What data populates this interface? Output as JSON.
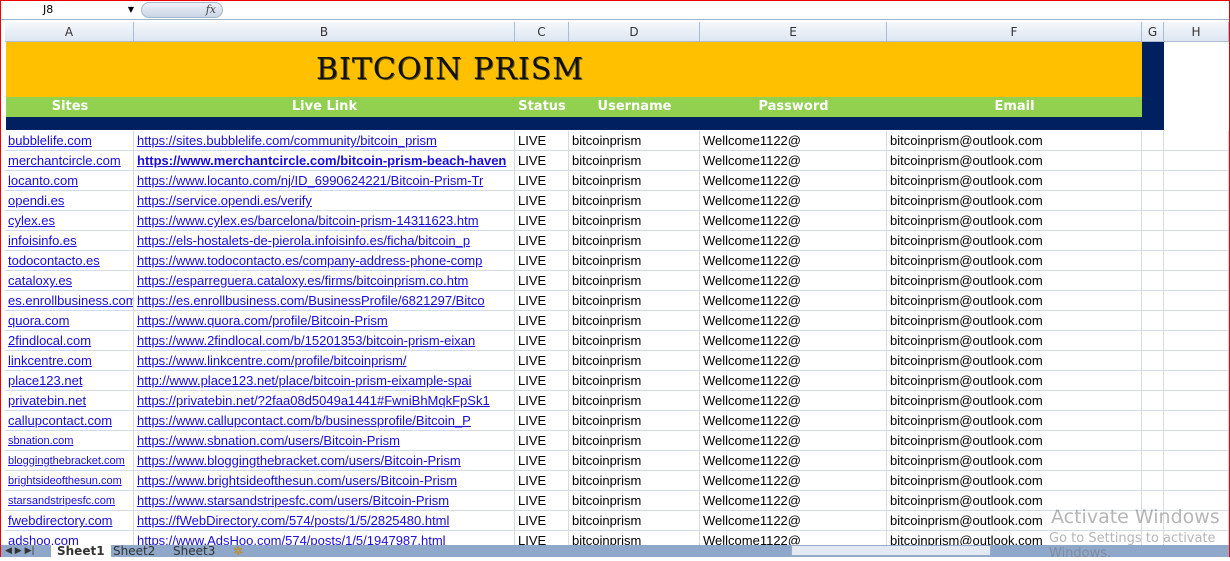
{
  "formula_bar": {
    "name_box": "J8",
    "fx": "fx"
  },
  "columns": [
    "A",
    "B",
    "C",
    "D",
    "E",
    "F",
    "G",
    "H"
  ],
  "title": "BITCOIN PRISM",
  "headers": [
    "Sites",
    "Live Link",
    "Status",
    "Username",
    "Password",
    "Email"
  ],
  "rows": [
    [
      "bubblelife.com",
      "https://sites.bubblelife.com/community/bitcoin_prism",
      "LIVE",
      "bitcoinprism",
      "Wellcome1122@",
      "bitcoinprism@outlook.com"
    ],
    [
      "merchantcircle.com",
      "https://www.merchantcircle.com/bitcoin-prism-beach-haven",
      "LIVE",
      "bitcoinprism",
      "Wellcome1122@",
      "bitcoinprism@outlook.com"
    ],
    [
      "locanto.com",
      "https://www.locanto.com/nj/ID_6990624221/Bitcoin-Prism-Tr",
      "LIVE",
      "bitcoinprism",
      "Wellcome1122@",
      "bitcoinprism@outlook.com"
    ],
    [
      "opendi.es",
      "https://service.opendi.es/verify",
      "LIVE",
      "bitcoinprism",
      "Wellcome1122@",
      "bitcoinprism@outlook.com"
    ],
    [
      "cylex.es",
      "https://www.cylex.es/barcelona/bitcoin-prism-14311623.htm",
      "LIVE",
      "bitcoinprism",
      "Wellcome1122@",
      "bitcoinprism@outlook.com"
    ],
    [
      "infoisinfo.es",
      "https://els-hostalets-de-pierola.infoisinfo.es/ficha/bitcoin_p",
      "LIVE",
      "bitcoinprism",
      "Wellcome1122@",
      "bitcoinprism@outlook.com"
    ],
    [
      "todocontacto.es",
      "https://www.todocontacto.es/company-address-phone-comp",
      "LIVE",
      "bitcoinprism",
      "Wellcome1122@",
      "bitcoinprism@outlook.com"
    ],
    [
      "cataloxy.es",
      "https://esparreguera.cataloxy.es/firms/bitcoinprism.co.htm",
      "LIVE",
      "bitcoinprism",
      "Wellcome1122@",
      "bitcoinprism@outlook.com"
    ],
    [
      "es.enrollbusiness.com",
      "https://es.enrollbusiness.com/BusinessProfile/6821297/Bitco",
      "LIVE",
      "bitcoinprism",
      "Wellcome1122@",
      "bitcoinprism@outlook.com"
    ],
    [
      "quora.com",
      "https://www.quora.com/profile/Bitcoin-Prism",
      "LIVE",
      "bitcoinprism",
      "Wellcome1122@",
      "bitcoinprism@outlook.com"
    ],
    [
      "2findlocal.com",
      "https://www.2findlocal.com/b/15201353/bitcoin-prism-eixan",
      "LIVE",
      "bitcoinprism",
      "Wellcome1122@",
      "bitcoinprism@outlook.com"
    ],
    [
      "linkcentre.com",
      "https://www.linkcentre.com/profile/bitcoinprism/",
      "LIVE",
      "bitcoinprism",
      "Wellcome1122@",
      "bitcoinprism@outlook.com"
    ],
    [
      "place123.net",
      "http://www.place123.net/place/bitcoin-prism-eixample-spai",
      "LIVE",
      "bitcoinprism",
      "Wellcome1122@",
      "bitcoinprism@outlook.com"
    ],
    [
      "privatebin.net",
      "https://privatebin.net/?2faa08d5049a1441#FwniBhMqkFpSk1",
      "LIVE",
      "bitcoinprism",
      "Wellcome1122@",
      "bitcoinprism@outlook.com"
    ],
    [
      "callupcontact.com",
      "https://www.callupcontact.com/b/businessprofile/Bitcoin_P",
      "LIVE",
      "bitcoinprism",
      "Wellcome1122@",
      "bitcoinprism@outlook.com"
    ],
    [
      "sbnation.com",
      "https://www.sbnation.com/users/Bitcoin-Prism",
      "LIVE",
      "bitcoinprism",
      "Wellcome1122@",
      "bitcoinprism@outlook.com"
    ],
    [
      "bloggingthebracket.com",
      "https://www.bloggingthebracket.com/users/Bitcoin-Prism",
      "LIVE",
      "bitcoinprism",
      "Wellcome1122@",
      "bitcoinprism@outlook.com"
    ],
    [
      "brightsideofthesun.com",
      "https://www.brightsideofthesun.com/users/Bitcoin-Prism",
      "LIVE",
      "bitcoinprism",
      "Wellcome1122@",
      "bitcoinprism@outlook.com"
    ],
    [
      "starsandstripesfc.com",
      "https://www.starsandstripesfc.com/users/Bitcoin-Prism",
      "LIVE",
      "bitcoinprism",
      "Wellcome1122@",
      "bitcoinprism@outlook.com"
    ],
    [
      "fwebdirectory.com",
      "https://fWebDirectory.com/574/posts/1/5/2825480.html",
      "LIVE",
      "bitcoinprism",
      "Wellcome1122@",
      "bitcoinprism@outlook.com"
    ],
    [
      "adshoo.com",
      "https://www.AdsHoo.com/574/posts/1/5/1947987.html",
      "LIVE",
      "bitcoinprism",
      "Wellcome1122@",
      "bitcoinprism@outlook.com"
    ]
  ],
  "sheet_tabs": [
    "Sheet1",
    "Sheet2",
    "Sheet3"
  ],
  "watermark": {
    "line1": "Activate Windows",
    "line2": "Go to Settings to activate Windows."
  },
  "colors": {
    "title_bg": "#ffc000",
    "header_bg": "#92d050",
    "band": "#002060",
    "link": "#1a0dd9"
  }
}
